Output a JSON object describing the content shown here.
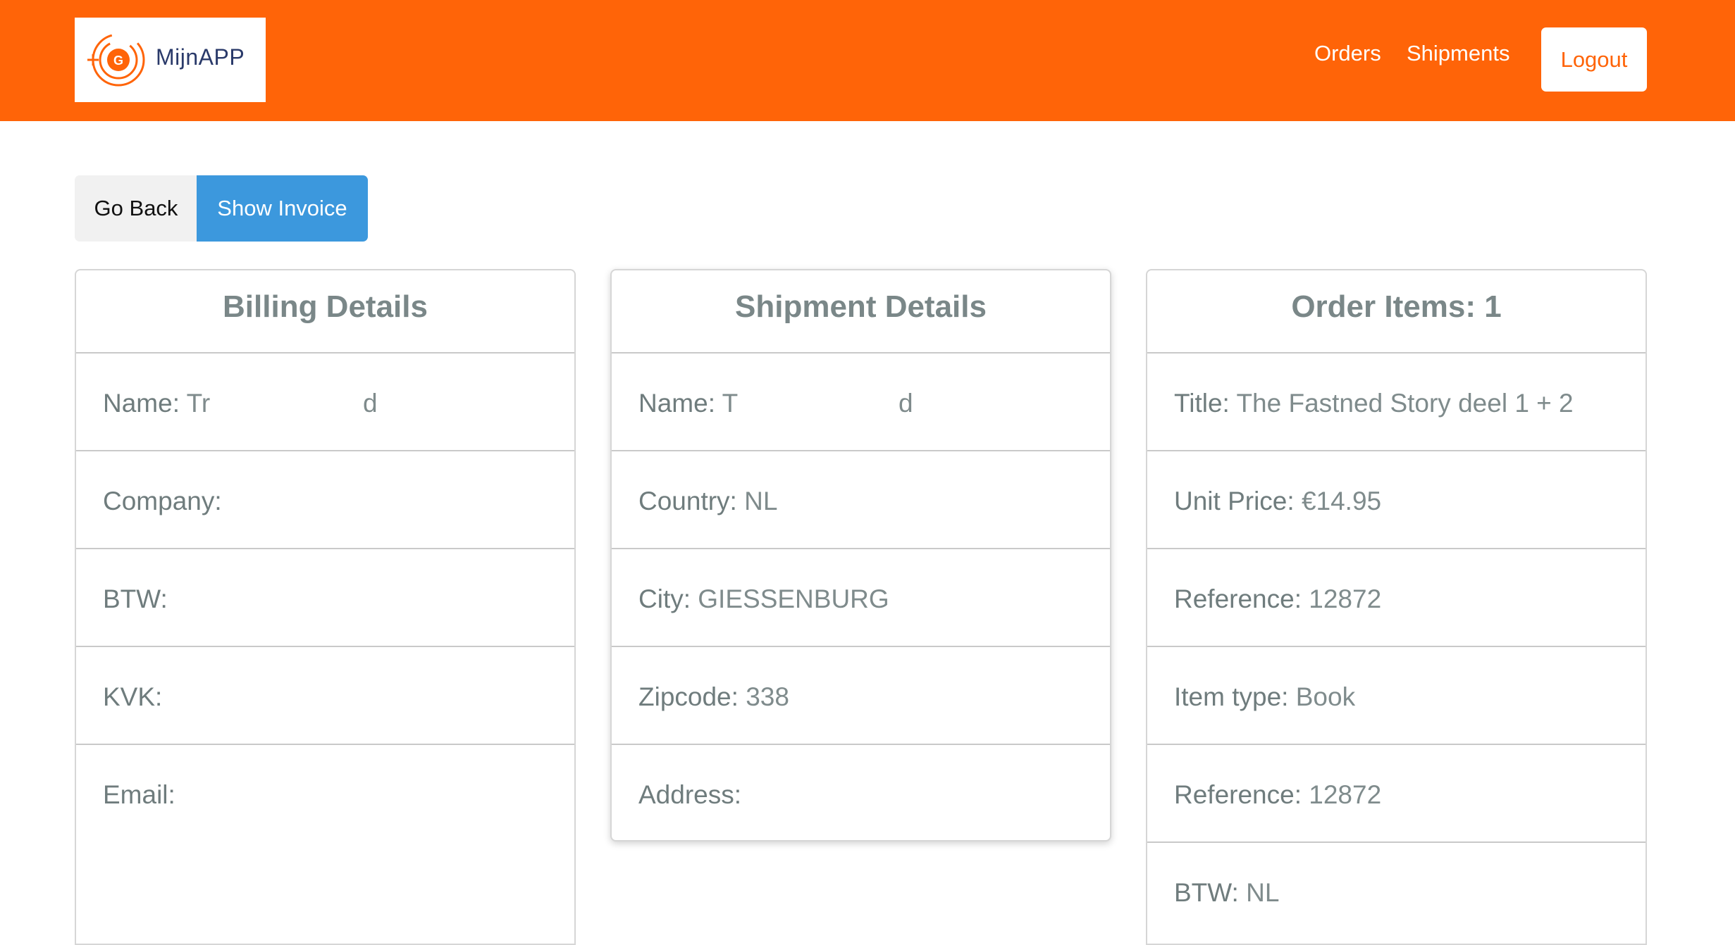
{
  "navbar": {
    "brand_text": "MijnAPP",
    "logo_letter": "G",
    "links": [
      "Orders",
      "Shipments"
    ],
    "logout_label": "Logout",
    "color": "#ff6408"
  },
  "actions": {
    "go_back": "Go Back",
    "show_invoice": "Show Invoice"
  },
  "billing": {
    "title": "Billing Details",
    "rows": [
      {
        "label": "Name:",
        "value": "Tr",
        "tail": "d"
      },
      {
        "label": "Company:",
        "value": ""
      },
      {
        "label": "BTW:",
        "value": ""
      },
      {
        "label": "KVK:",
        "value": ""
      },
      {
        "label": "Email:",
        "value": ""
      }
    ]
  },
  "shipment": {
    "title": "Shipment Details",
    "rows": [
      {
        "label": "Name:",
        "value": "T",
        "tail": "d"
      },
      {
        "label": "Country:",
        "value": "NL"
      },
      {
        "label": "City:",
        "value": "GIESSENBURG"
      },
      {
        "label": "Zipcode:",
        "value": "338"
      },
      {
        "label": "Address:",
        "value": ""
      }
    ]
  },
  "items": {
    "title": "Order Items: 1",
    "rows": [
      {
        "label": "Title:",
        "value": "The Fastned Story deel 1 + 2"
      },
      {
        "label": "Unit Price:",
        "value": "€14.95"
      },
      {
        "label": "Reference:",
        "value": "12872"
      },
      {
        "label": "Item type:",
        "value": "Book"
      },
      {
        "label": "Reference:",
        "value": "12872"
      },
      {
        "label": "BTW:",
        "value": "NL"
      }
    ]
  }
}
